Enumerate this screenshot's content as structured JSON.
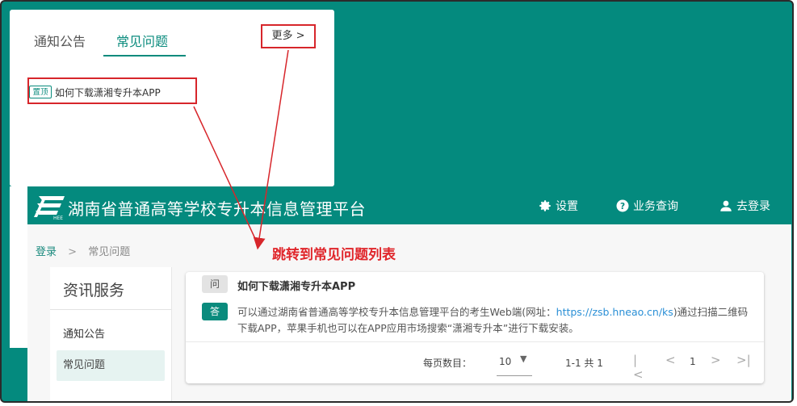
{
  "popup": {
    "tabs": [
      {
        "label": "通知公告"
      },
      {
        "label": "常见问题"
      }
    ],
    "more_label": "更多 >",
    "item_badge": "置顶",
    "item_text": "如何下载潇湘专升本APP"
  },
  "app": {
    "title": "湖南省普通高等学校专升本信息管理平台",
    "header_buttons": {
      "settings": "设置",
      "query": "业务查询",
      "login": "去登录"
    },
    "breadcrumb": {
      "home": "登录",
      "separator": ">",
      "current": "常见问题"
    },
    "sidebar": {
      "title": "资讯服务",
      "items": [
        {
          "label": "通知公告"
        },
        {
          "label": "常见问题"
        }
      ]
    },
    "faq": {
      "q_badge": "问",
      "question": "如何下载潇湘专升本APP",
      "a_badge": "答",
      "answer_part1": "可以通过湖南省普通高等学校专升本信息管理平台的考生Web端(网址：",
      "answer_url": "https://zsb.hneao.cn/ks",
      "answer_part2": ")通过扫描二维码下载APP，苹果手机也可以在APP应用市场搜索“潇湘专升本”进行下载安装。"
    },
    "pagination": {
      "per_page_label": "每页数目：",
      "per_page_value": "10",
      "range_text": "1-1 共 1",
      "current_page": "1"
    }
  },
  "annotation": "跳转到常见问题列表",
  "colors": {
    "brand": "#048a7e",
    "highlight": "#d7262b"
  }
}
